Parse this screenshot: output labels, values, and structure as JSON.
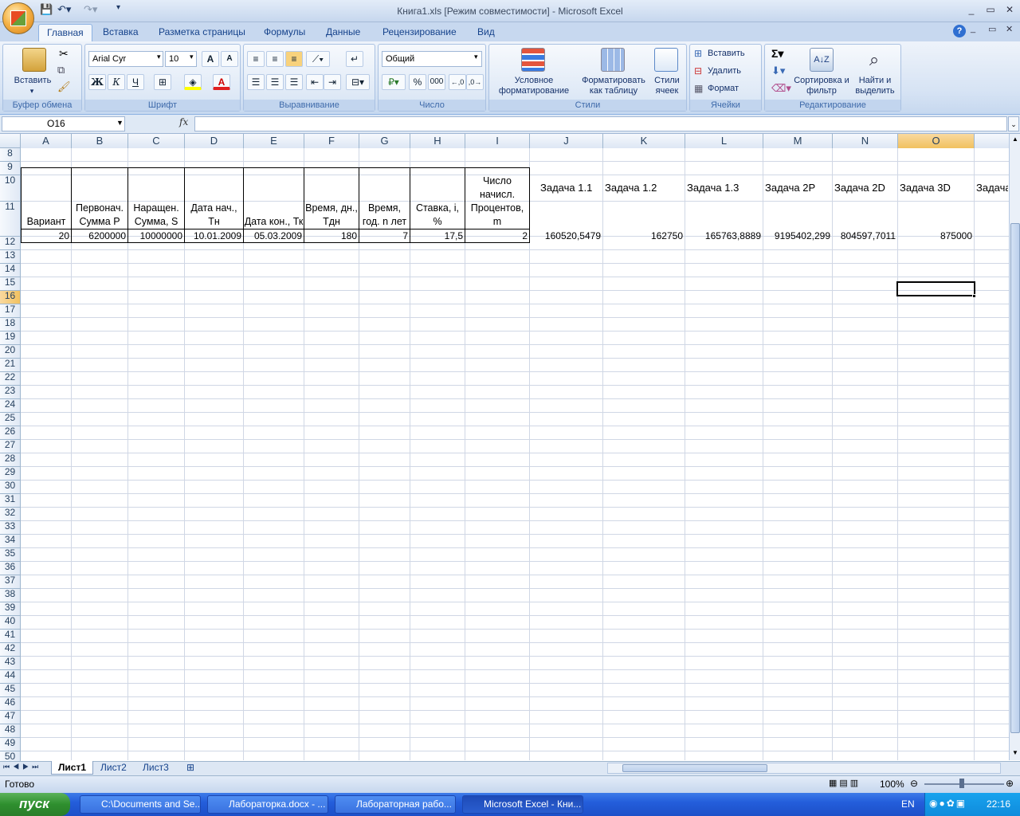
{
  "window": {
    "title": "Книга1.xls  [Режим совместимости] - Microsoft Excel",
    "qat": {
      "undo_icon": "undo-icon",
      "redo_icon": "redo-icon",
      "save_icon": "save-icon"
    },
    "controls": [
      "_",
      "▭",
      "✕"
    ]
  },
  "ribbon": {
    "tabs": [
      "Главная",
      "Вставка",
      "Разметка страницы",
      "Формулы",
      "Данные",
      "Рецензирование",
      "Вид"
    ],
    "active_tab": "Главная",
    "groups": {
      "clipboard": {
        "label": "Буфер обмена",
        "paste": "Вставить"
      },
      "font": {
        "label": "Шрифт",
        "font_name": "Arial Cyr",
        "font_size": "10",
        "bold": "Ж",
        "italic": "К",
        "underline": "Ч"
      },
      "alignment": {
        "label": "Выравнивание"
      },
      "number": {
        "label": "Число",
        "format": "Общий",
        "percent": "%",
        "thousands": "000"
      },
      "styles": {
        "label": "Стили",
        "conditional": "Условное форматирование",
        "as_table": "Форматировать как таблицу",
        "cell_styles": "Стили ячеек"
      },
      "cells": {
        "label": "Ячейки",
        "insert": "Вставить",
        "delete": "Удалить",
        "format": "Формат"
      },
      "editing": {
        "label": "Редактирование",
        "sort": "Сортировка и фильтр",
        "find": "Найти и выделить"
      }
    }
  },
  "formula_bar": {
    "name_box": "O16",
    "fx": "fx",
    "content": ""
  },
  "grid": {
    "columns": [
      "A",
      "B",
      "C",
      "D",
      "E",
      "F",
      "G",
      "H",
      "I",
      "J",
      "K",
      "L",
      "M",
      "N",
      "O"
    ],
    "selected_column": "O",
    "rows": [
      "8",
      "9",
      "10",
      "11",
      "12",
      "13",
      "14",
      "15",
      "16",
      "17",
      "18",
      "19",
      "20",
      "21",
      "22",
      "23",
      "24",
      "25",
      "26",
      "27",
      "28",
      "29",
      "30",
      "31",
      "32",
      "33",
      "34",
      "35",
      "36",
      "37",
      "38",
      "39",
      "40",
      "41",
      "42",
      "43",
      "44",
      "45",
      "46",
      "47",
      "48",
      "49",
      "50"
    ],
    "selected_row": "16",
    "table_headers": [
      "Вариант",
      "Первонач. Сумма P",
      "Наращен. Сумма, S",
      "Дата нач., Тн",
      "Дата кон., Тк",
      "Время, дн., Тдн",
      "Время, год. n лет",
      "Ставка, i, %",
      "Число начисл. Процентов, m"
    ],
    "table_values": [
      "20",
      "6200000",
      "10000000",
      "10.01.2009",
      "05.03.2009",
      "180",
      "7",
      "17,5",
      "2"
    ],
    "task_headers": [
      "Задача 1.1",
      "Задача 1.2",
      "Задача 1.3",
      "Задача 2P",
      "Задача 2D",
      "Задача 3D",
      "Задача"
    ],
    "task_values": [
      "160520,5479",
      "162750",
      "165763,8889",
      "9195402,299",
      "804597,7011",
      "875000"
    ]
  },
  "sheets": {
    "tabs": [
      "Лист1",
      "Лист2",
      "Лист3"
    ],
    "active": "Лист1"
  },
  "status": {
    "text": "Готово",
    "zoom": "100%"
  },
  "taskbar": {
    "start": "пуск",
    "items": [
      "C:\\Documents and Se...",
      "Лабораторка.docx - ...",
      "Лабораторная рабо...",
      "Microsoft Excel - Кни..."
    ],
    "lang": "EN",
    "clock": "22:16"
  }
}
